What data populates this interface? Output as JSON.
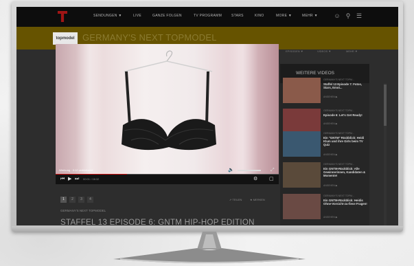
{
  "nav": {
    "items": [
      {
        "label": "SENDUNGEN ▼"
      },
      {
        "label": "LIVE"
      },
      {
        "label": "GANZE FOLGEN"
      },
      {
        "label": "TV PROGRAMM"
      },
      {
        "label": "STARS"
      },
      {
        "label": "KINO"
      },
      {
        "label": "MORE ▼"
      },
      {
        "label": "MEHR ▼"
      }
    ]
  },
  "show": {
    "logo_text": "topmodel",
    "title": "GERMANY'S NEXT TOPMODEL",
    "subnav": [
      "EPISODEN ▼",
      "VIDEOS ▼",
      "MEHR ▼"
    ]
  },
  "player": {
    "ad_label": "Werbung · 0:12 verbleibend",
    "time": "00:01 / 08:32",
    "progress_fraction": 0.32
  },
  "pagination": {
    "pages": [
      "1",
      "2",
      "3",
      "4"
    ],
    "active_index": 0
  },
  "share": {
    "like": "TEILEN",
    "tweet": "MERKEN"
  },
  "episode": {
    "breadcrumb": "GERMANY'S NEXT TOPMODEL",
    "title": "STAFFEL 13 EPISODE 6: GNTM HIP-HOP EDITION"
  },
  "sidebar": {
    "title": "WEITERE VIDEOS",
    "videos": [
      {
        "category": "GERMANY'S NEXT TOPM...",
        "title": "Staffel 13 Episode 7: Fotos, Stars, Emot...",
        "cta": "ANSEHEN ▶",
        "thumb_color": "#8a5a4a"
      },
      {
        "category": "GERMANY'S NEXT TOPM...",
        "title": "Episode 6: Let's Get Ready!",
        "cta": "ANSEHEN ▶",
        "thumb_color": "#7a3a3a"
      },
      {
        "category": "GERMANY'S NEXT TOPM...",
        "title": "Ein \"GNTM\" Rückblick: Heidi Klum und ihre Girls beim TV Quiz",
        "cta": "ANSEHEN ▶",
        "thumb_color": "#3a5870"
      },
      {
        "category": "GERMANY'S NEXT TOPM...",
        "title": "Ein GNTM-Rückblick: Alle Gewinnerinnen, Kandidaten & Momente!",
        "cta": "ANSEHEN ▶",
        "thumb_color": "#5a4a3a"
      },
      {
        "category": "GERMANY'S NEXT TOPM...",
        "title": "Ein GNTM-Rückblick: Heidis Ohne-Vorsicht-zu-fiese Fragen!",
        "cta": "ANSEHEN ▶",
        "thumb_color": "#6a4a44"
      }
    ]
  },
  "colors": {
    "brand_red": "#a01515",
    "banner": "#665300",
    "progress": "#cc1111"
  }
}
